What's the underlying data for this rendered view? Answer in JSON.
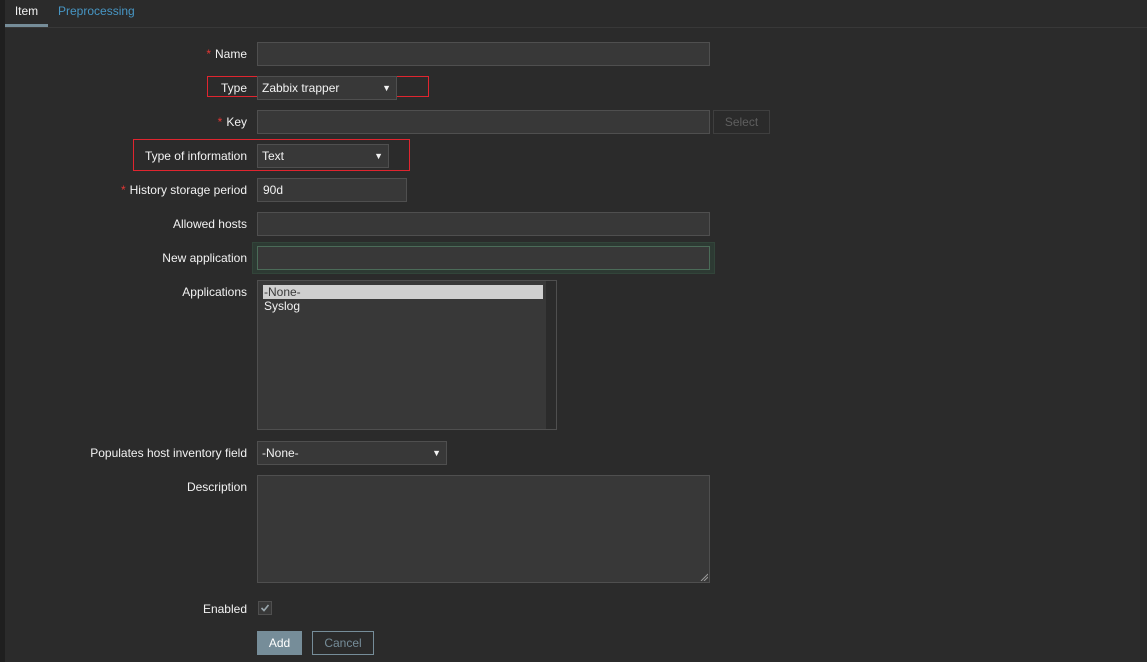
{
  "tabs": {
    "item": "Item",
    "preprocessing": "Preprocessing"
  },
  "form": {
    "required_mark": "*",
    "name": {
      "label": "Name",
      "value": ""
    },
    "type": {
      "label": "Type",
      "value": "Zabbix trapper"
    },
    "key": {
      "label": "Key",
      "value": "",
      "select_button": "Select"
    },
    "type_of_information": {
      "label": "Type of information",
      "value": "Text"
    },
    "history_storage_period": {
      "label": "History storage period",
      "value": "90d"
    },
    "allowed_hosts": {
      "label": "Allowed hosts",
      "value": ""
    },
    "new_application": {
      "label": "New application",
      "value": ""
    },
    "applications": {
      "label": "Applications",
      "options": [
        "-None-",
        "Syslog"
      ],
      "selected": "-None-"
    },
    "populates_host_inventory_field": {
      "label": "Populates host inventory field",
      "value": "-None-"
    },
    "description": {
      "label": "Description",
      "value": ""
    },
    "enabled": {
      "label": "Enabled",
      "checked": true
    },
    "buttons": {
      "add": "Add",
      "cancel": "Cancel"
    }
  },
  "icons": {
    "dropdown": "chevron-down-icon",
    "check": "checkmark-icon",
    "resize": "resize-grip-icon"
  },
  "colors": {
    "background": "#2b2b2b",
    "link": "#4796c4",
    "required": "#e33734",
    "highlight": "#e0252f",
    "primary_button": "#768d99"
  }
}
